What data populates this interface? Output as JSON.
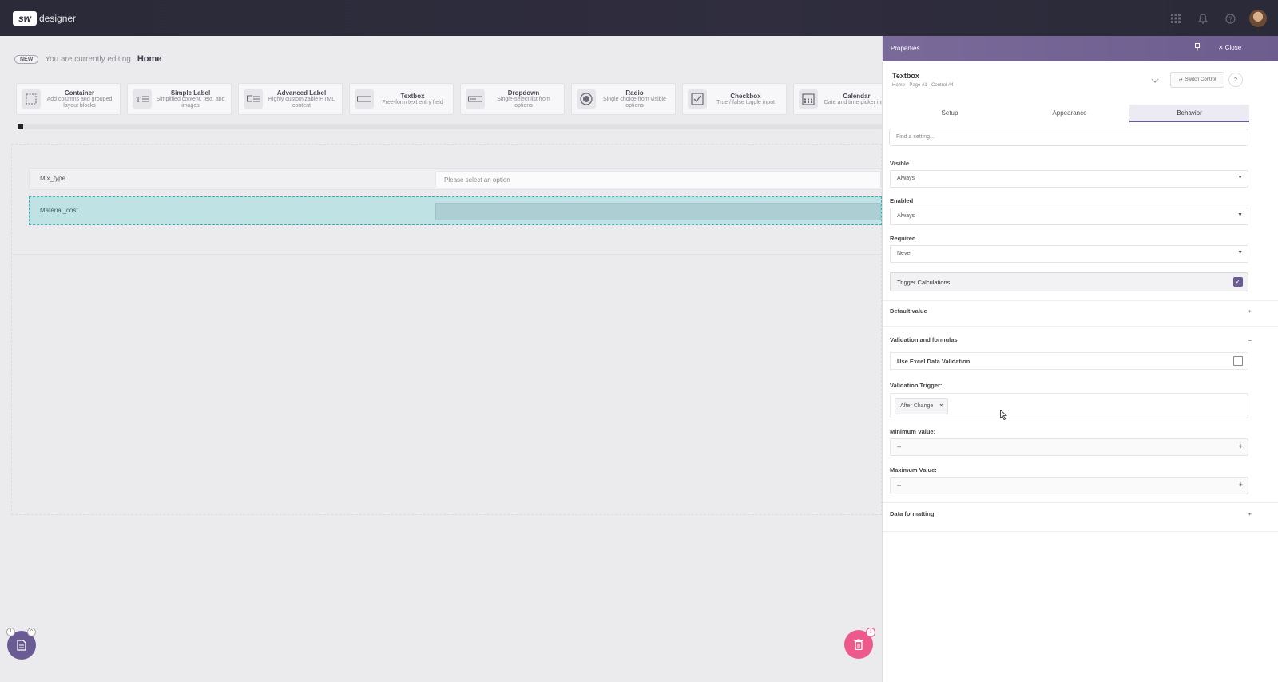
{
  "app": {
    "logo_mark": "sw",
    "logo_text": "designer"
  },
  "topbar": {
    "icons": [
      "grid-icon",
      "bell-icon",
      "help-icon"
    ]
  },
  "editing": {
    "badge": "NEW",
    "prefix": "You are currently editing",
    "page": "Home"
  },
  "palette": [
    {
      "icon": "container-icon",
      "title": "Container",
      "desc": "Add columns and grouped layout blocks"
    },
    {
      "icon": "simple-label-icon",
      "title": "Simple Label",
      "desc": "Simplified content, text, and images"
    },
    {
      "icon": "advanced-label-icon",
      "title": "Advanced Label",
      "desc": "Highly customizable HTML content"
    },
    {
      "icon": "textbox-icon",
      "title": "Textbox",
      "desc": "Free-form text entry field"
    },
    {
      "icon": "dropdown-icon",
      "title": "Dropdown",
      "desc": "Single-select list from options"
    },
    {
      "icon": "radio-icon",
      "title": "Radio",
      "desc": "Single choice from visible options"
    },
    {
      "icon": "checkbox-icon",
      "title": "Checkbox",
      "desc": "True / false toggle input"
    },
    {
      "icon": "calendar-icon",
      "title": "Calendar",
      "desc": "Date and time picker input"
    }
  ],
  "canvas": {
    "row1": {
      "label": "Mix_type",
      "placeholder": "Please select an option"
    },
    "row2": {
      "label": "Material_cost"
    }
  },
  "fabs": {
    "left_badges": [
      "1",
      "^"
    ],
    "right_badge": "1"
  },
  "panel": {
    "title": "Properties",
    "close": "Close",
    "control_name": "Textbox",
    "control_path": "Home · Page #1 · Control #4",
    "switch_label": "Switch Control",
    "help": "?",
    "tabs": [
      "Setup",
      "Appearance",
      "Behavior"
    ],
    "active_tab": "Behavior",
    "search_placeholder": "Find a setting...",
    "visible": {
      "label": "Visible",
      "value": "Always"
    },
    "enabled": {
      "label": "Enabled",
      "value": "Always"
    },
    "required": {
      "label": "Required",
      "value": "Never"
    },
    "trigger": {
      "label": "Trigger Calculations",
      "checked": true
    },
    "default_value": {
      "label": "Default value",
      "toggle": "+"
    },
    "validation": {
      "label": "Validation and formulas",
      "toggle": "–"
    },
    "excel": {
      "label": "Use Excel Data Validation",
      "checked": false
    },
    "validation_trigger": {
      "label": "Validation Trigger:",
      "chip": "After Change",
      "chip_remove": "×"
    },
    "min": {
      "label": "Minimum Value:",
      "minus": "–",
      "plus": "+"
    },
    "max": {
      "label": "Maximum Value:",
      "minus": "–",
      "plus": "+"
    },
    "data_formatting": {
      "label": "Data formatting",
      "toggle": "+"
    }
  },
  "colors": {
    "accent": "#6b5b94",
    "selection": "#2db5ba",
    "trash": "#ec5a8c"
  }
}
